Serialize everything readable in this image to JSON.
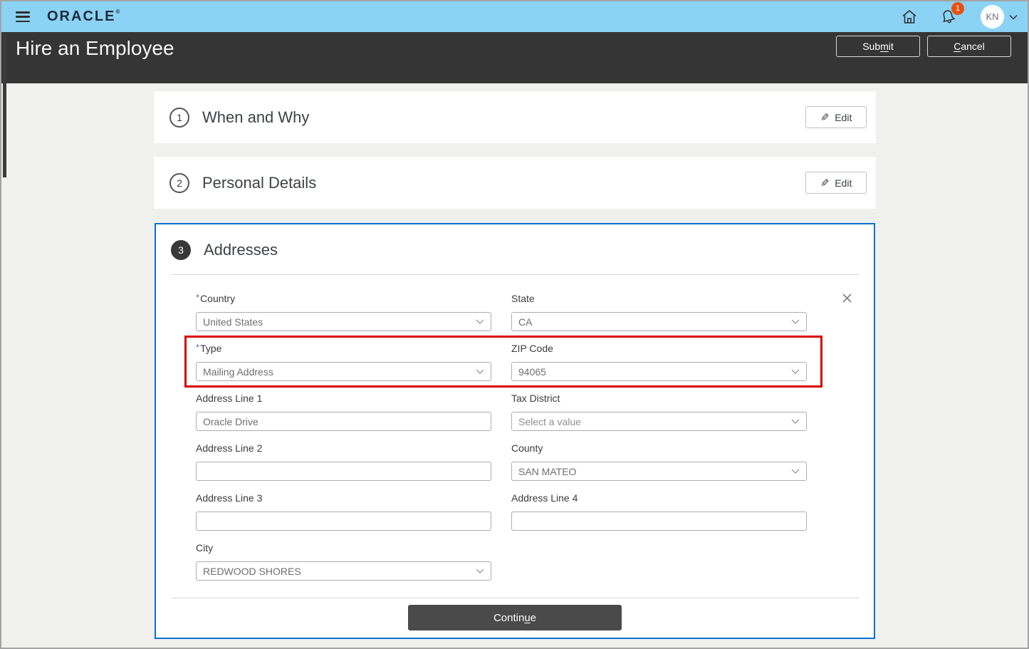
{
  "colors": {
    "topbar_bg": "#8bd3f5",
    "page_header_bg": "#353535",
    "active_card_border": "#0572ce",
    "annotation_red": "#d60000",
    "badge_orange": "#e8500f",
    "continue_bg": "#4a4a4a"
  },
  "topbar": {
    "brand": "ORACLE",
    "brand_mark": "®",
    "notification_count": "1",
    "avatar_initials": "KN"
  },
  "header": {
    "title": "Hire an Employee",
    "submit": {
      "pre": "Sub",
      "accel": "m",
      "post": "it"
    },
    "cancel": {
      "pre": "",
      "accel": "C",
      "post": "ancel"
    }
  },
  "sections": [
    {
      "number": "1",
      "title": "When and Why",
      "edit_label": "Edit"
    },
    {
      "number": "2",
      "title": "Personal Details",
      "edit_label": "Edit"
    }
  ],
  "addresses": {
    "number": "3",
    "title": "Addresses",
    "required_marker": "*",
    "form": {
      "country": {
        "label": "Country",
        "value": "United States"
      },
      "state": {
        "label": "State",
        "value": "CA"
      },
      "type": {
        "label": "Type",
        "value": "Mailing Address"
      },
      "zip": {
        "label": "ZIP Code",
        "value": "94065"
      },
      "address1": {
        "label": "Address Line 1",
        "value": "Oracle Drive"
      },
      "tax_district": {
        "label": "Tax District",
        "placeholder": "Select a value"
      },
      "address2": {
        "label": "Address Line 2",
        "value": ""
      },
      "county": {
        "label": "County",
        "value": "SAN MATEO"
      },
      "address3": {
        "label": "Address Line 3",
        "value": ""
      },
      "address4": {
        "label": "Address Line 4",
        "value": ""
      },
      "city": {
        "label": "City",
        "value": "REDWOOD SHORES"
      }
    },
    "continue": {
      "pre": "Contin",
      "accel": "u",
      "post": "e"
    }
  },
  "icons": {
    "edit_pencil": "✎"
  }
}
